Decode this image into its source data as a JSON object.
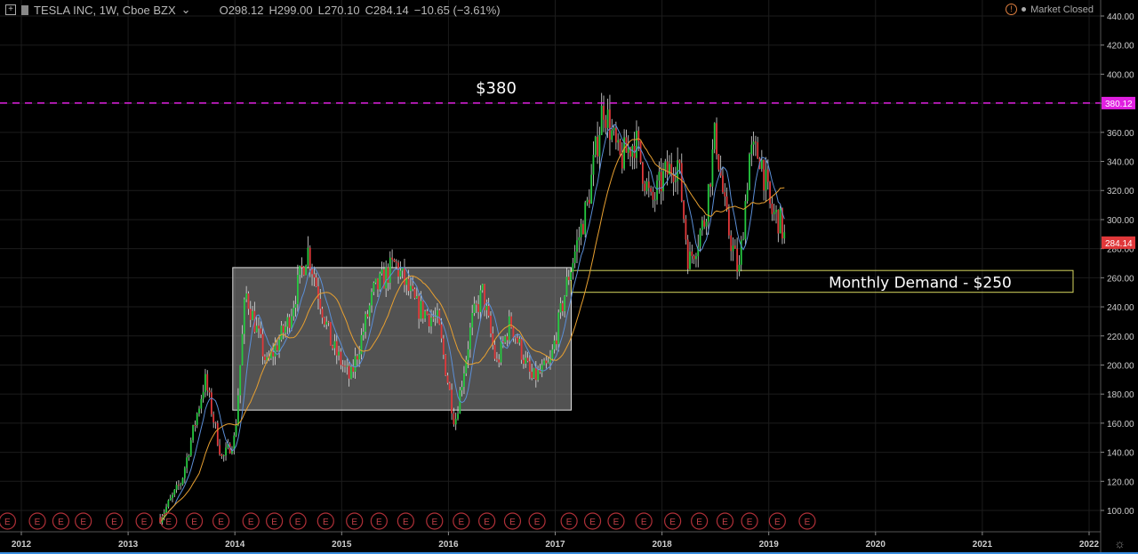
{
  "header": {
    "symbol": "TESLA INC, 1W, Cboe BZX",
    "open": "O298.12",
    "high": "H299.00",
    "low": "L270.10",
    "close": "C284.14",
    "change": "−10.65 (−3.61%)",
    "market_status": "Market Closed"
  },
  "colors": {
    "up": "#26c940",
    "down": "#e0383a",
    "ma_fast": "#5b8fd8",
    "ma_slow": "#e8a030",
    "resistance": "#e020e0",
    "demand_box": "#d8d860",
    "range_box": "#9a9a9a",
    "last_price": "#e0383a"
  },
  "chart_data": {
    "type": "candlestick",
    "title": "TESLA INC, 1W, Cboe BZX",
    "y_ticks": [
      "100.00",
      "120.00",
      "140.00",
      "160.00",
      "180.00",
      "200.00",
      "220.00",
      "240.00",
      "260.00",
      "280.00",
      "300.00",
      "320.00",
      "340.00",
      "360.00",
      "380.00",
      "400.00",
      "420.00",
      "440.00"
    ],
    "ylim": [
      100,
      440
    ],
    "x_ticks": [
      "2012",
      "2013",
      "2014",
      "2015",
      "2016",
      "2017",
      "2018",
      "2019",
      "2020",
      "2021",
      "2022"
    ],
    "xlim": [
      2011.9,
      2022.1
    ],
    "price_path": [
      [
        2013.3,
        95
      ],
      [
        2013.5,
        120
      ],
      [
        2013.72,
        190
      ],
      [
        2013.88,
        135
      ],
      [
        2014.0,
        150
      ],
      [
        2014.1,
        250
      ],
      [
        2014.3,
        200
      ],
      [
        2014.5,
        230
      ],
      [
        2014.68,
        280
      ],
      [
        2014.9,
        215
      ],
      [
        2015.08,
        190
      ],
      [
        2015.3,
        250
      ],
      [
        2015.5,
        270
      ],
      [
        2015.7,
        240
      ],
      [
        2015.9,
        230
      ],
      [
        2016.06,
        160
      ],
      [
        2016.22,
        230
      ],
      [
        2016.32,
        250
      ],
      [
        2016.45,
        200
      ],
      [
        2016.58,
        230
      ],
      [
        2016.78,
        190
      ],
      [
        2016.95,
        200
      ],
      [
        2017.12,
        260
      ],
      [
        2017.3,
        310
      ],
      [
        2017.45,
        380
      ],
      [
        2017.6,
        340
      ],
      [
        2017.75,
        355
      ],
      [
        2017.9,
        310
      ],
      [
        2018.02,
        330
      ],
      [
        2018.15,
        340
      ],
      [
        2018.25,
        270
      ],
      [
        2018.4,
        300
      ],
      [
        2018.5,
        360
      ],
      [
        2018.6,
        300
      ],
      [
        2018.72,
        262
      ],
      [
        2018.82,
        345
      ],
      [
        2018.92,
        345
      ],
      [
        2019.02,
        305
      ],
      [
        2019.1,
        300
      ],
      [
        2019.16,
        284.14
      ]
    ],
    "last_price": 284.14,
    "last_price_label": "284.14",
    "resistance_level": 380.12,
    "resistance_label": "380.12",
    "range_box": {
      "from": 2013.98,
      "to": 2017.15,
      "low": 169,
      "high": 267
    },
    "demand_zone": {
      "from": 2017.15,
      "to": 2021.85,
      "low": 250,
      "high": 265
    },
    "annotations": [
      "$380",
      "Monthly Demand - $250"
    ],
    "earnings_marker": "E",
    "earnings_dates": [
      2011.87,
      2012.15,
      2012.37,
      2012.58,
      2012.87,
      2013.15,
      2013.38,
      2013.62,
      2013.87,
      2014.15,
      2014.37,
      2014.59,
      2014.85,
      2015.12,
      2015.35,
      2015.6,
      2015.87,
      2016.12,
      2016.36,
      2016.6,
      2016.83,
      2017.13,
      2017.35,
      2017.57,
      2017.83,
      2018.1,
      2018.35,
      2018.59,
      2018.82,
      2019.08,
      2019.36
    ]
  }
}
